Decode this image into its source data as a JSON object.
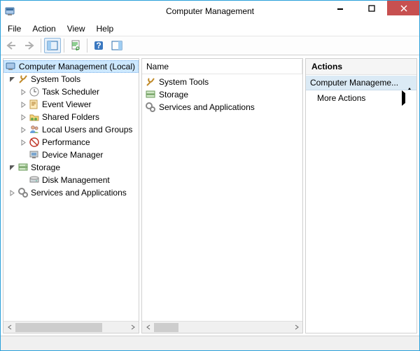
{
  "window": {
    "title": "Computer Management"
  },
  "menu": {
    "file": "File",
    "action": "Action",
    "view": "View",
    "help": "Help"
  },
  "tree": {
    "root": "Computer Management (Local)",
    "system_tools": "System Tools",
    "task_scheduler": "Task Scheduler",
    "event_viewer": "Event Viewer",
    "shared_folders": "Shared Folders",
    "local_users_groups": "Local Users and Groups",
    "performance": "Performance",
    "device_manager": "Device Manager",
    "storage": "Storage",
    "disk_management": "Disk Management",
    "services_apps": "Services and Applications"
  },
  "list": {
    "header_name": "Name",
    "items": {
      "system_tools": "System Tools",
      "storage": "Storage",
      "services_apps": "Services and Applications"
    }
  },
  "actions": {
    "header": "Actions",
    "group_title": "Computer Manageme...",
    "more_actions": "More Actions"
  }
}
